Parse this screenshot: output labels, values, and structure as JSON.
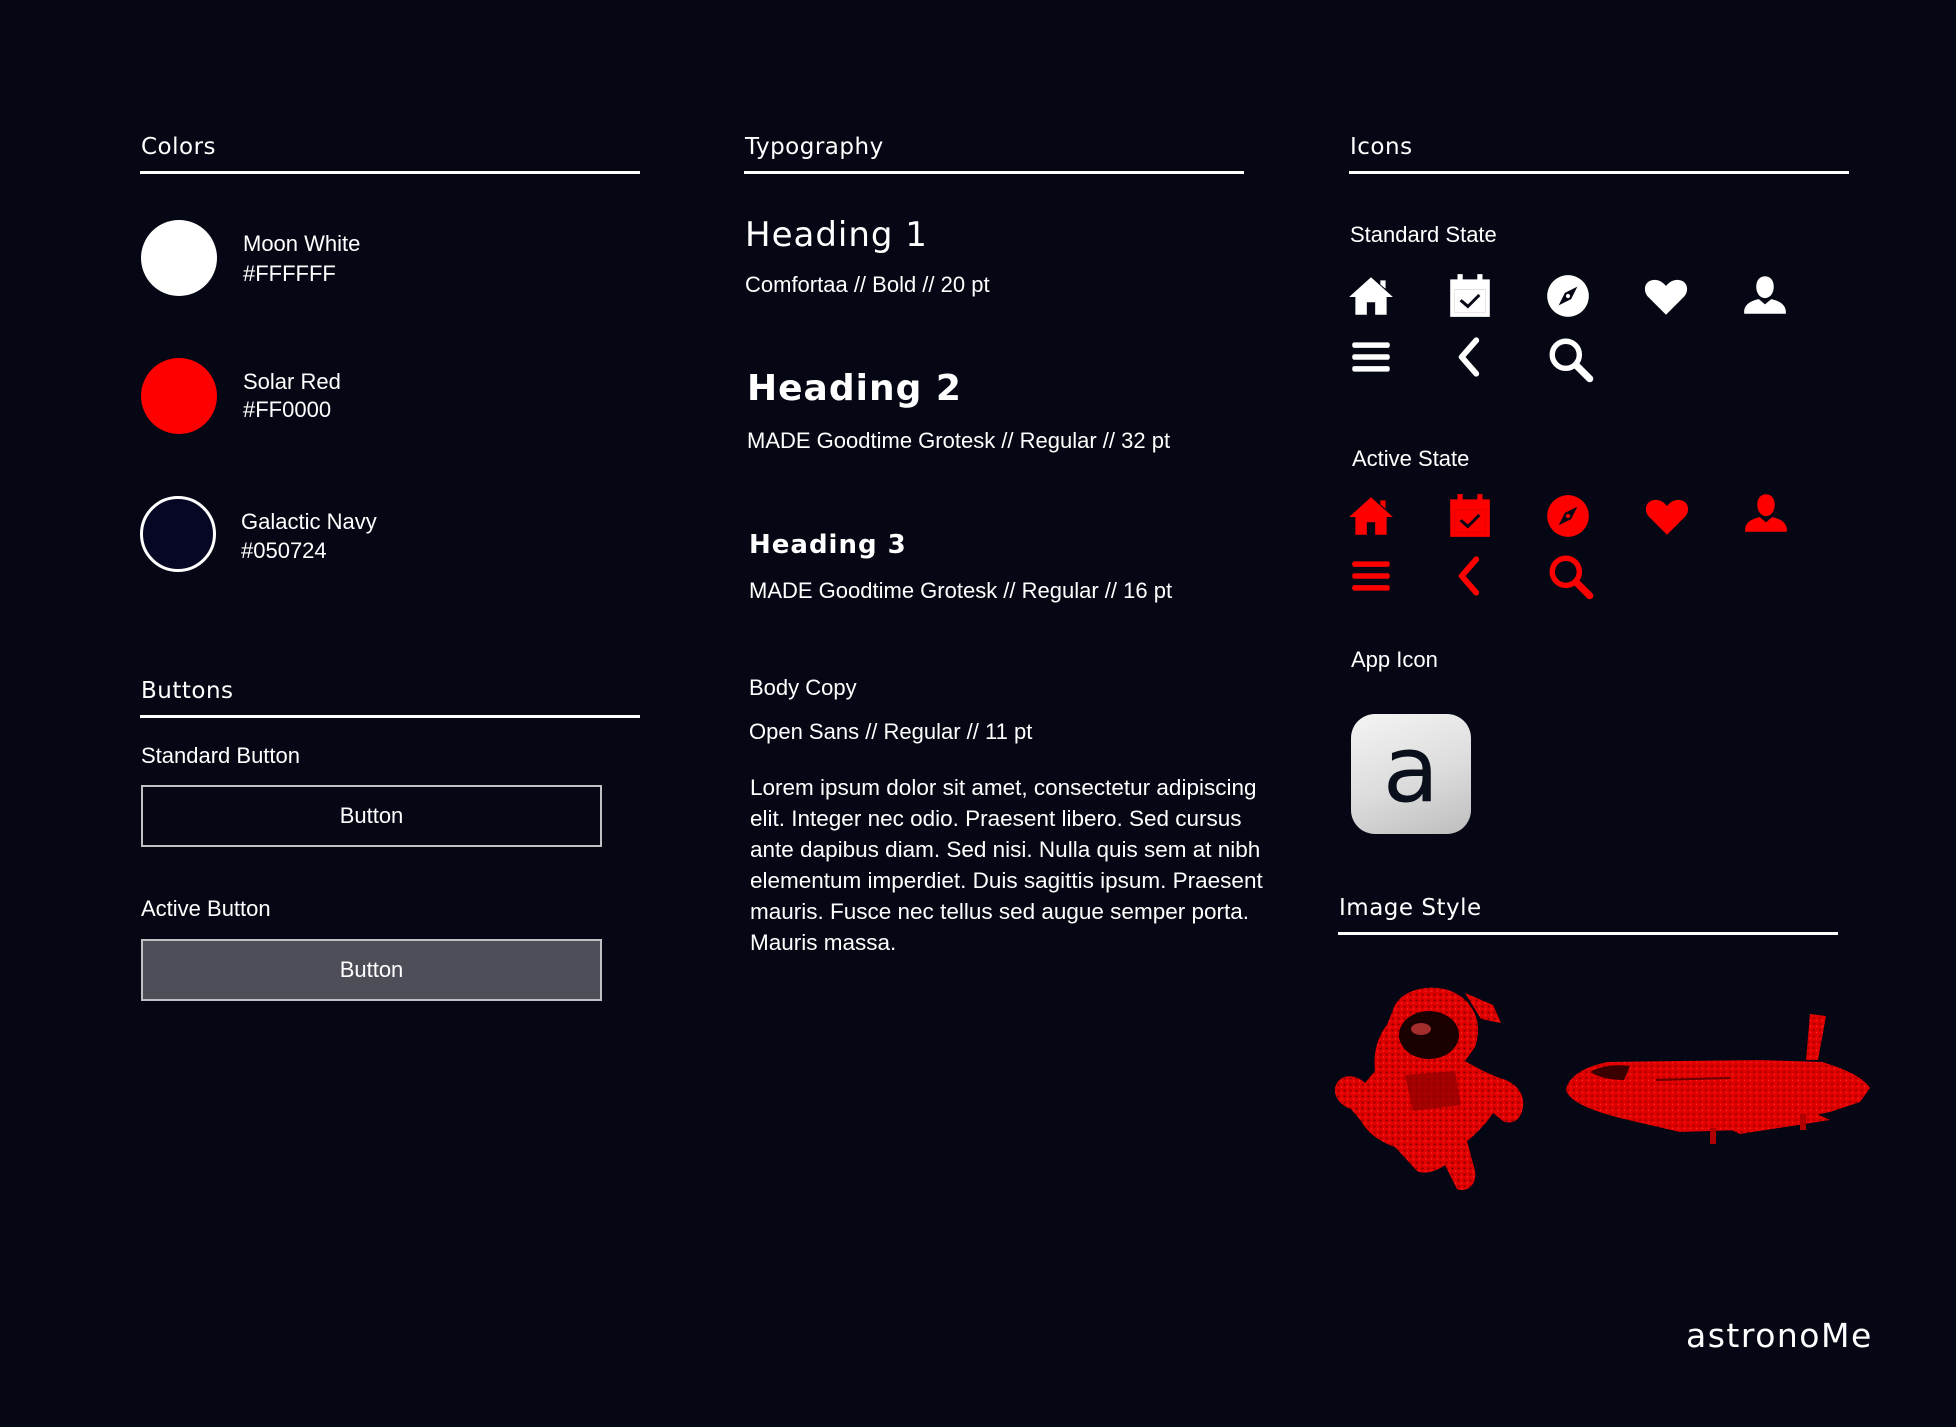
{
  "colors": {
    "title": "Colors",
    "items": [
      {
        "name": "Moon White",
        "hex": "#FFFFFF"
      },
      {
        "name": "Solar Red",
        "hex": "#FF0000"
      },
      {
        "name": "Galactic Navy",
        "hex": "#050724"
      }
    ]
  },
  "buttons": {
    "title": "Buttons",
    "standard_label": "Standard  Button",
    "standard_button": "Button",
    "active_label": "Active  Button",
    "active_button": "Button"
  },
  "typography": {
    "title": "Typography",
    "heading1": {
      "sample": "Heading 1",
      "spec": "Comfortaa // Bold // 20 pt"
    },
    "heading2": {
      "sample": "Heading  2",
      "spec": "MADE Goodtime Grotesk // Regular // 32 pt"
    },
    "heading3": {
      "sample": "Heading  3",
      "spec": "MADE Goodtime Grotesk // Regular // 16 pt"
    },
    "body": {
      "label": "Body Copy",
      "spec": "Open Sans // Regular // 11 pt",
      "sample": "Lorem ipsum dolor sit amet, consectetur adipiscing elit. Integer nec odio. Praesent libero. Sed cursus ante dapibus diam. Sed nisi. Nulla quis sem at nibh elementum imperdiet. Duis sagittis ipsum. Praesent mauris. Fusce nec tellus sed augue semper porta. Mauris massa."
    }
  },
  "icons": {
    "title": "Icons",
    "standard_label": "Standard State",
    "active_label": "Active State",
    "set": [
      "home-icon",
      "calendar-icon",
      "compass-icon",
      "heart-icon",
      "user-icon",
      "menu-icon",
      "back-icon",
      "search-icon"
    ],
    "standard_color": "#FFFFFF",
    "active_color": "#FF0000",
    "app_icon_label": "App Icon",
    "app_icon_glyph": "a"
  },
  "image_style": {
    "title": "Image Style",
    "images": [
      "astronaut-image",
      "space-shuttle-image"
    ],
    "tint": "#FF0000"
  },
  "brand": {
    "wordmark": "astronoMe"
  }
}
